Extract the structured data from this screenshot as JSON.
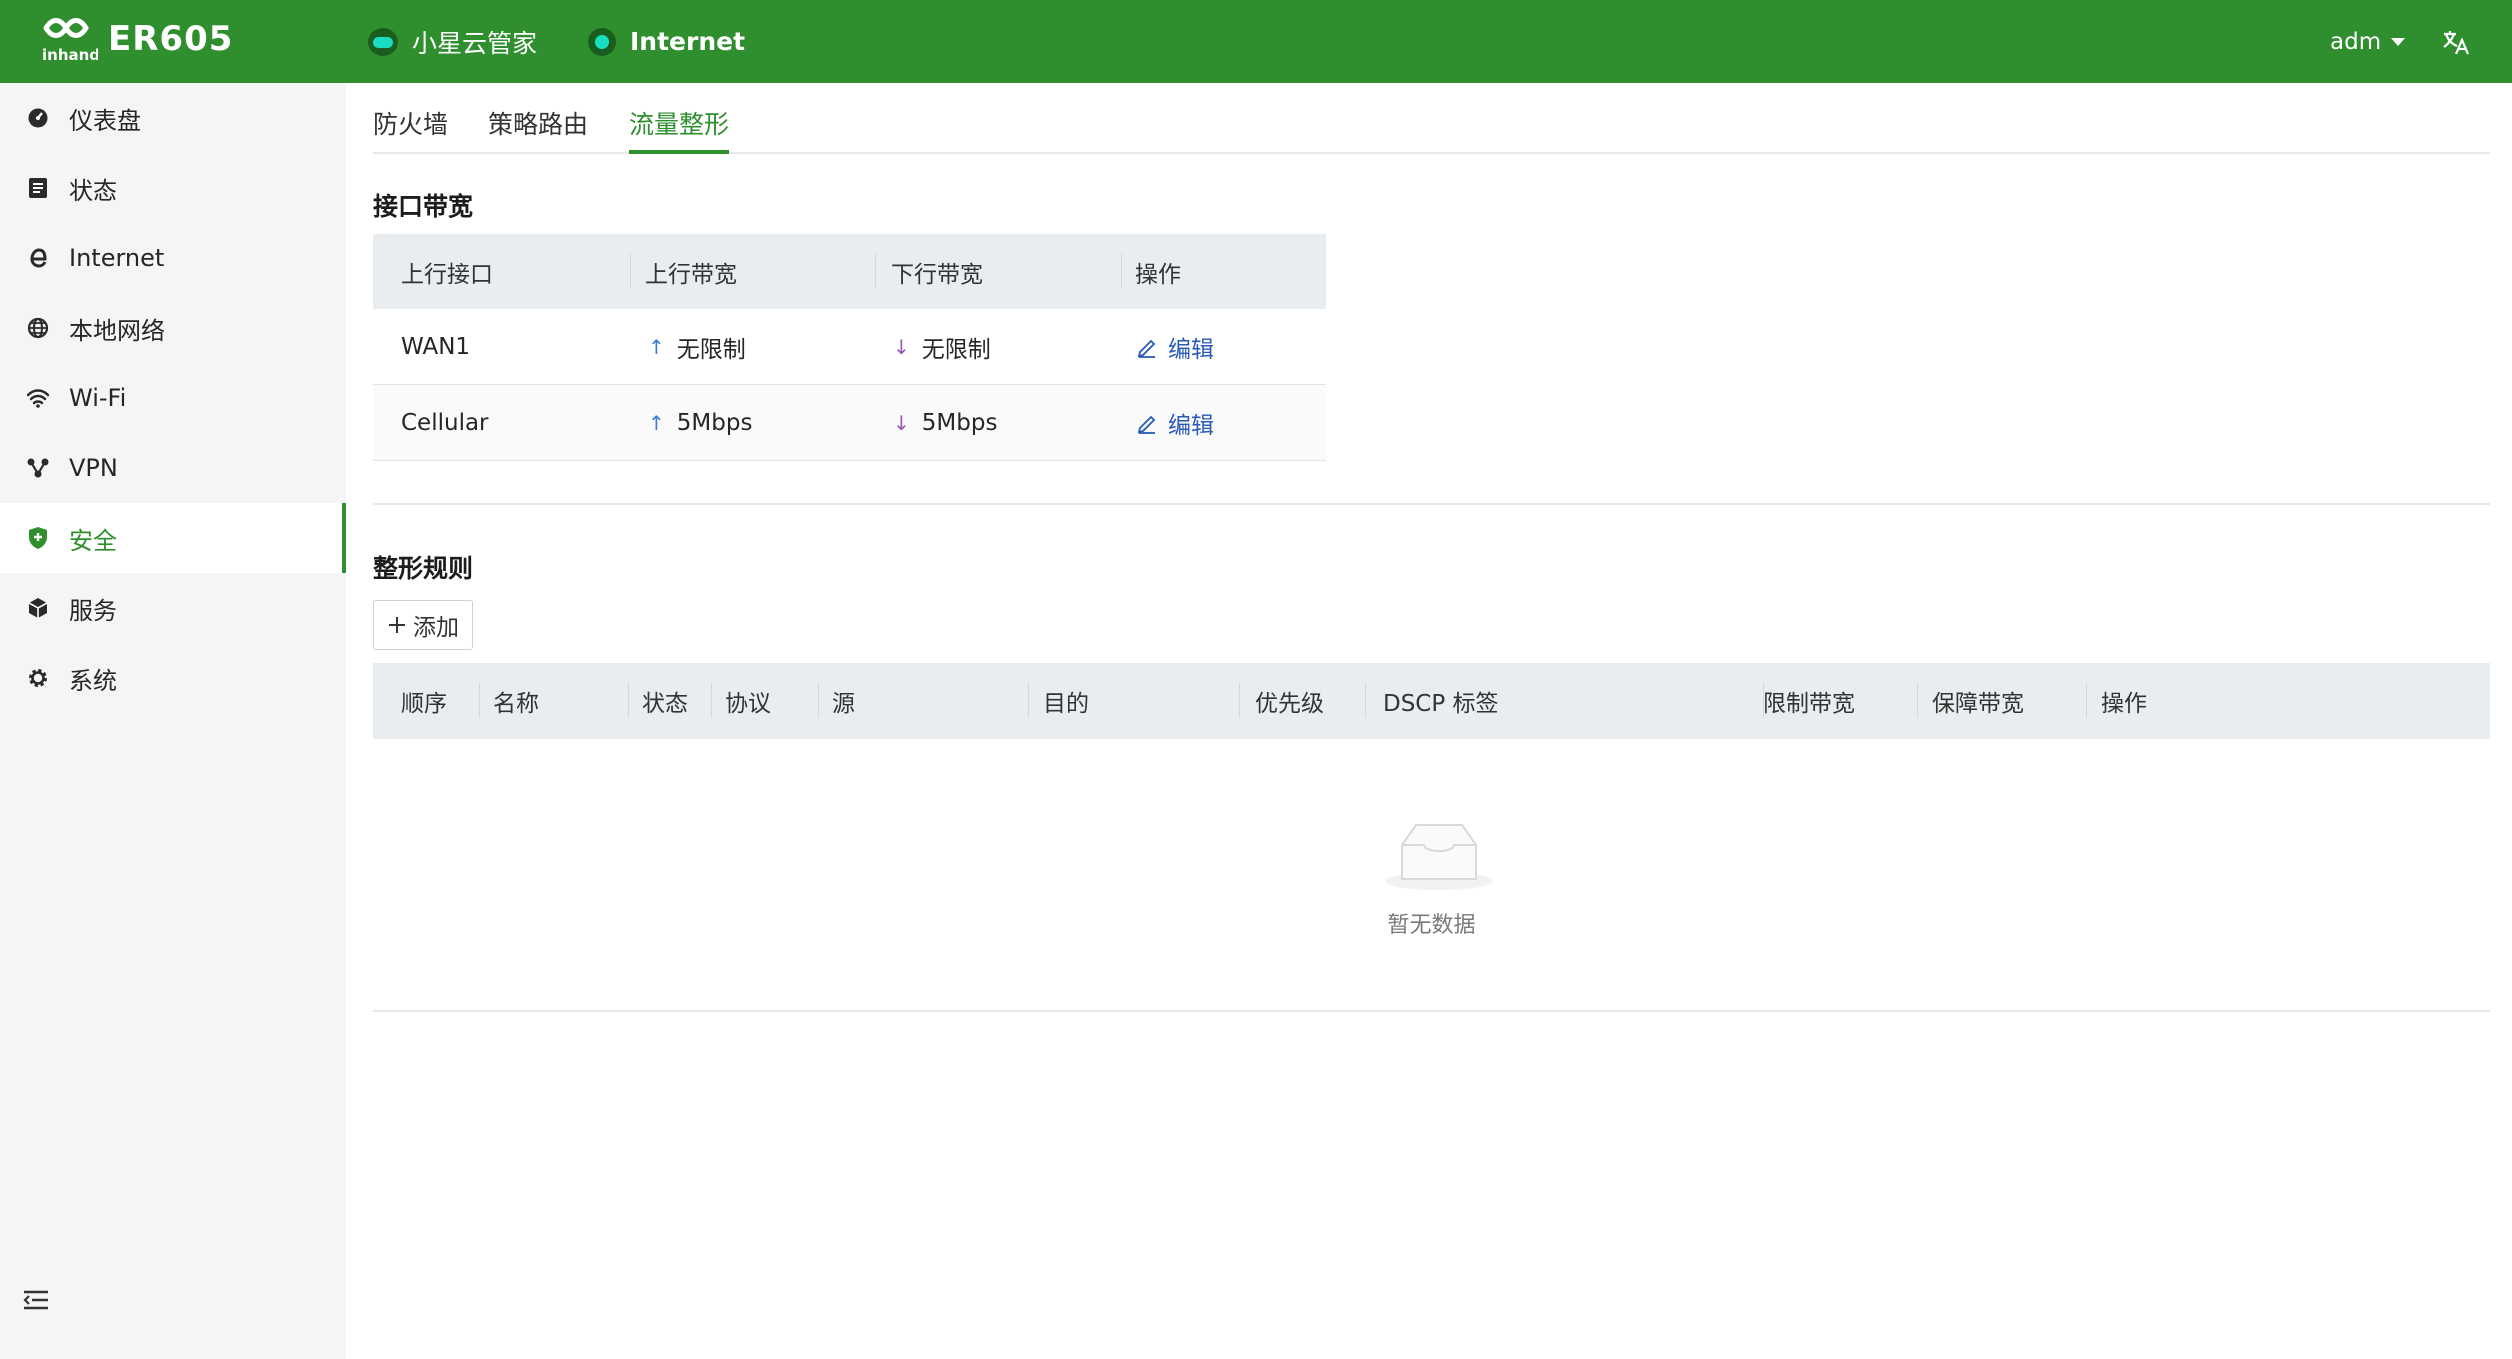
{
  "header": {
    "product": "ER605",
    "cloud_label": "小星云管家",
    "internet_label": "Internet",
    "user": "adm",
    "lang_icon": "translate-icon",
    "brand_color": "#2f8f2f"
  },
  "sidebar": {
    "items": [
      {
        "label": "仪表盘",
        "icon": "dashboard-icon"
      },
      {
        "label": "状态",
        "icon": "status-icon"
      },
      {
        "label": "Internet",
        "icon": "internet-icon"
      },
      {
        "label": "本地网络",
        "icon": "globe-icon"
      },
      {
        "label": "Wi-Fi",
        "icon": "wifi-icon"
      },
      {
        "label": "VPN",
        "icon": "vpn-icon"
      },
      {
        "label": "安全",
        "icon": "shield-icon",
        "active": true
      },
      {
        "label": "服务",
        "icon": "box-icon"
      },
      {
        "label": "系统",
        "icon": "gear-icon"
      }
    ]
  },
  "tabs": [
    {
      "label": "防火墙"
    },
    {
      "label": "策略路由"
    },
    {
      "label": "流量整形",
      "active": true
    }
  ],
  "bandwidth": {
    "title": "接口带宽",
    "columns": [
      "上行接口",
      "上行带宽",
      "下行带宽",
      "操作"
    ],
    "rows": [
      {
        "iface": "WAN1",
        "up": "无限制",
        "down": "无限制",
        "action": "编辑"
      },
      {
        "iface": "Cellular",
        "up": "5Mbps",
        "down": "5Mbps",
        "action": "编辑"
      }
    ]
  },
  "rules": {
    "title": "整形规则",
    "add_label": "添加",
    "columns": [
      "顺序",
      "名称",
      "状态",
      "协议",
      "源",
      "目的",
      "优先级",
      "DSCP 标签",
      "限制带宽",
      "保障带宽",
      "操作"
    ],
    "empty_text": "暂无数据"
  }
}
